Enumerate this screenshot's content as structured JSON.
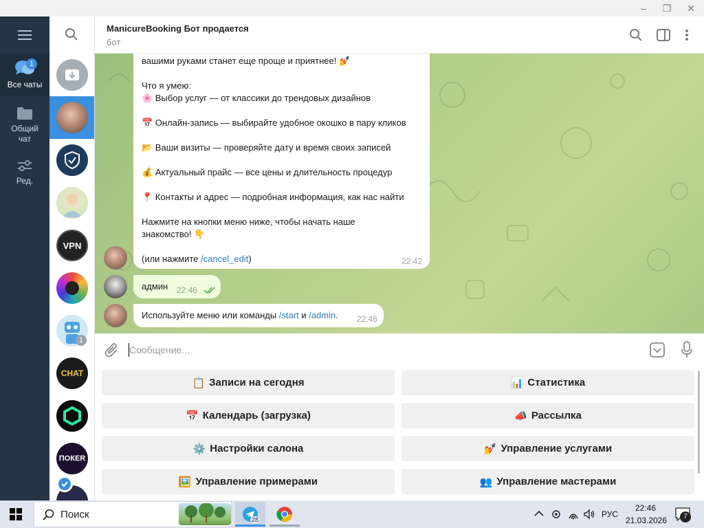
{
  "window": {
    "minimize": "–",
    "maximize": "❐",
    "close": "✕"
  },
  "rail": {
    "items": [
      {
        "label": "Все чаты",
        "badge": "1"
      },
      {
        "label": "Общий чат"
      },
      {
        "label": "Ред."
      }
    ]
  },
  "chatlist": {
    "unread_badge": "1",
    "vpn_label": "VPN",
    "chat_label": "CHAT",
    "poker_label": "ПОКЕR"
  },
  "header": {
    "title": "ManicureBooking Бот продается",
    "subtitle": "бот"
  },
  "messages": {
    "intro_tail": "вашими руками станет еще проще и приятнее! 💅",
    "can_do": "Что я умею:",
    "features": [
      "🌸 Выбор услуг — от классики до трендовых дизайнов",
      "📅 Онлайн-запись — выбирайте удобное окошко в пару кликов",
      "📂 Ваши визиты — проверяйте дату и время своих записей",
      "💰 Актуальный прайс — все цены и длительность процедур",
      "📍 Контакты и адрес — подробная информация, как нас найти"
    ],
    "cta_1": "Нажмите на кнопки меню ниже, чтобы начать наше",
    "cta_2": "знакомство! 👇",
    "cancel_prefix": "(или нажмите ",
    "cancel_cmd": "/cancel_edit",
    "cancel_suffix": ")",
    "time_1": "22:42",
    "admin_text": "админ",
    "time_2": "22:46",
    "reply_prefix": "Используйте меню или команды ",
    "reply_cmd1": "/start",
    "reply_mid": " и ",
    "reply_cmd2": "/admin",
    "reply_suffix": ".",
    "time_3": "22:46"
  },
  "composer": {
    "placeholder": "Сообщение..."
  },
  "keyboard": {
    "buttons": [
      {
        "emoji": "📋",
        "label": "Записи на сегодня"
      },
      {
        "emoji": "📊",
        "label": "Статистика"
      },
      {
        "emoji": "📅",
        "label": "Календарь (загрузка)"
      },
      {
        "emoji": "📣",
        "label": "Рассылка"
      },
      {
        "emoji": "⚙️",
        "label": "Настройки салона"
      },
      {
        "emoji": "💅",
        "label": "Управление услугами"
      },
      {
        "emoji": "🖼️",
        "label": "Управление примерами"
      },
      {
        "emoji": "👥",
        "label": "Управление мастерами"
      }
    ]
  },
  "taskbar": {
    "search_label": "Поиск",
    "telegram_badge": "28",
    "lang": "РУС",
    "time": "22:46",
    "date": "21.03.2026",
    "notif_count": "7"
  }
}
